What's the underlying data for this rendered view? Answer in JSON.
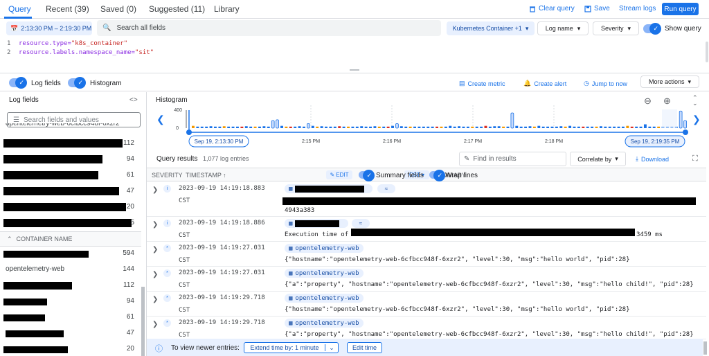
{
  "tabs": [
    {
      "label": "Query",
      "active": true
    },
    {
      "label": "Recent (39)"
    },
    {
      "label": "Saved (0)"
    },
    {
      "label": "Suggested (11)"
    },
    {
      "label": "Library"
    }
  ],
  "top_actions": {
    "clear_query": "Clear query",
    "save": "Save",
    "stream_logs": "Stream logs",
    "run_query": "Run query"
  },
  "time_range": "2:13:30 PM – 2:19:30 PM",
  "search_placeholder": "Search all fields",
  "resource_chip": "Kubernetes Container +1",
  "dropdowns": {
    "log_name": "Log name",
    "severity": "Severity"
  },
  "show_query": "Show query",
  "query_lines": [
    {
      "num": "1",
      "key": "resource.type=",
      "value": "\"k8s_container\""
    },
    {
      "num": "2",
      "key": "resource.labels.namespace_name=",
      "value": "\"sit\""
    }
  ],
  "toolbar": {
    "log_fields": "Log fields",
    "histogram": "Histogram",
    "create_metric": "Create metric",
    "create_alert": "Create alert",
    "jump_to_now": "Jump to now",
    "more_actions": "More actions"
  },
  "log_fields_panel": {
    "title": "Log fields",
    "search_placeholder": "Search fields and values",
    "partial_top": "opentelemetry-web-6cfbcc948f-6xzr2",
    "rows_top": [
      "112",
      "94",
      "61",
      "47",
      "20",
      "5"
    ],
    "section_title": "CONTAINER NAME",
    "container_rows": [
      {
        "label": "",
        "count": "594"
      },
      {
        "label": "opentelemetry-web",
        "count": "144"
      },
      {
        "label": "",
        "count": "112"
      },
      {
        "label": "",
        "count": "94"
      },
      {
        "label": "",
        "count": "61"
      },
      {
        "label": "",
        "count": "47"
      },
      {
        "label": "",
        "count": "20"
      }
    ]
  },
  "histogram": {
    "title": "Histogram",
    "y_max": "400",
    "y_min": "0",
    "start_label": "Sep 19, 2:13:30 PM",
    "end_label": "Sep 19, 2:19:35 PM",
    "ticks": [
      "2:15 PM",
      "2:16 PM",
      "2:17 PM",
      "2:18 PM"
    ]
  },
  "chart_data": {
    "type": "bar",
    "title": "Histogram",
    "ylim": [
      0,
      400
    ],
    "x_start": "Sep 19, 2:13:30 PM",
    "x_end": "Sep 19, 2:19:35 PM",
    "tick_labels": [
      "2:15 PM",
      "2:16 PM",
      "2:17 PM",
      "2:18 PM"
    ],
    "values": [
      6,
      4,
      4,
      4,
      5,
      4,
      4,
      5,
      4,
      4,
      4,
      4,
      5,
      4,
      4,
      4,
      5,
      4,
      20,
      22,
      6,
      4,
      4,
      4,
      5,
      4,
      12,
      6,
      4,
      5,
      4,
      4,
      4,
      5,
      4,
      4,
      4,
      4,
      5,
      4,
      4,
      5,
      4,
      4,
      4,
      6,
      12,
      5,
      4,
      4,
      4,
      4,
      4,
      4,
      4,
      4,
      4,
      4,
      6,
      4,
      5,
      4,
      4,
      4,
      4,
      4,
      6,
      4,
      5,
      5,
      4,
      4,
      40,
      6,
      4,
      4,
      5,
      4,
      6,
      4,
      4,
      4,
      4,
      5,
      4,
      6,
      4,
      4,
      4,
      4,
      4,
      4,
      5,
      4,
      4,
      4,
      4,
      4,
      6,
      4,
      4,
      4,
      10,
      4,
      4,
      4,
      4,
      4,
      4,
      4,
      45,
      20
    ],
    "series_colors": [
      "#1a73e8",
      "#f29900",
      "#d93025"
    ]
  },
  "results": {
    "title": "Query results",
    "count": "1,077 log entries",
    "find_placeholder": "Find in results",
    "correlate": "Correlate by",
    "download": "Download"
  },
  "columns": {
    "severity": "SEVERITY",
    "timestamp": "TIMESTAMP",
    "tz": "CST",
    "summary": "SUMMARY",
    "edit": "EDIT",
    "summary_fields": "Summary fields",
    "wrap_lines": "Wrap lines"
  },
  "rows": [
    {
      "sev": "i",
      "ts": "2023-09-19 14:19:18.883",
      "tz": "CST",
      "chip": "",
      "line": "",
      "line_end": "4943a383"
    },
    {
      "sev": "i",
      "ts": "2023-09-19 14:19:18.886",
      "tz": "CST",
      "chip": "",
      "line": "Execution time of",
      "line_end": "3459 ms"
    },
    {
      "sev": "*",
      "ts": "2023-09-19 14:19:27.031",
      "tz": "CST",
      "chip": "opentelemetry-web",
      "line": "{\"hostname\":\"opentelemetry-web-6cfbcc948f-6xzr2\", \"level\":30, \"msg\":\"hello world\", \"pid\":28}"
    },
    {
      "sev": "*",
      "ts": "2023-09-19 14:19:27.031",
      "tz": "CST",
      "chip": "opentelemetry-web",
      "line": "{\"a\":\"property\", \"hostname\":\"opentelemetry-web-6cfbcc948f-6xzr2\", \"level\":30, \"msg\":\"hello child!\", \"pid\":28}"
    },
    {
      "sev": "*",
      "ts": "2023-09-19 14:19:29.718",
      "tz": "CST",
      "chip": "opentelemetry-web",
      "line": "{\"hostname\":\"opentelemetry-web-6cfbcc948f-6xzr2\", \"level\":30, \"msg\":\"hello world\", \"pid\":28}"
    },
    {
      "sev": "*",
      "ts": "2023-09-19 14:19:29.718",
      "tz": "CST",
      "chip": "opentelemetry-web",
      "line": "{\"a\":\"property\", \"hostname\":\"opentelemetry-web-6cfbcc948f-6xzr2\", \"level\":30, \"msg\":\"hello child!\", \"pid\":28}"
    }
  ],
  "bottom_bar": {
    "text": "To view newer entries:",
    "extend": "Extend time by: 1 minute",
    "edit_time": "Edit time"
  }
}
